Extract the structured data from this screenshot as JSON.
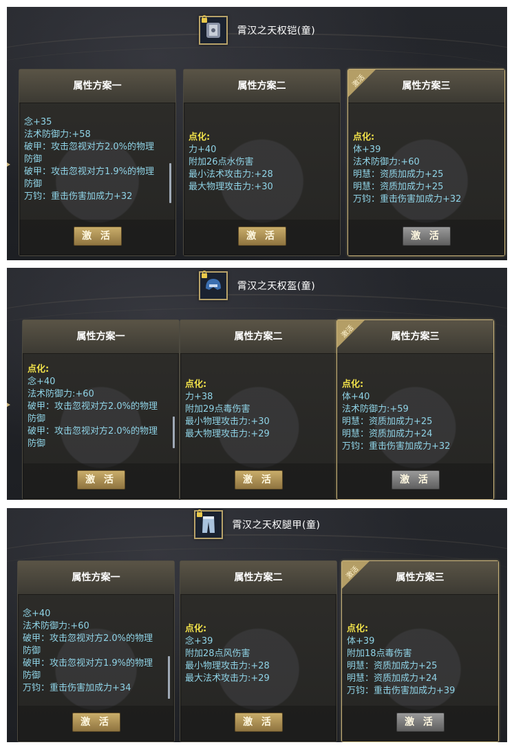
{
  "panels": [
    {
      "item_name": "霄汉之天权铠(童)",
      "item_icon": "armor-icon",
      "button_label": "激 活",
      "active_ribbon": "激活",
      "cards": [
        {
          "title": "属性方案一",
          "lines": [
            "念+35",
            "法术防御力:+58",
            "破甲：攻击忽视对方2.0%的物理",
            "防御",
            "破甲：攻击忽视对方1.9%的物理",
            "防御",
            "万钧：重击伤害加成力+32"
          ]
        },
        {
          "title": "属性方案二",
          "lines": [
            "点化:",
            "力+40",
            "附加26点水伤害",
            "最小法术攻击力:+28",
            "最大物理攻击力:+30"
          ]
        },
        {
          "title": "属性方案三",
          "lines": [
            "点化:",
            "体+39",
            "法术防御力:+60",
            "明慧：资质加成力+25",
            "明慧：资质加成力+25",
            "万钧：重击伤害加成力+32"
          ]
        }
      ]
    },
    {
      "item_name": "霄汉之天权盔(童)",
      "item_icon": "helmet-icon",
      "button_label": "激 活",
      "active_ribbon": "激活",
      "cards": [
        {
          "title": "属性方案一",
          "lines": [
            "点化:",
            "念+40",
            "法术防御力:+60",
            "破甲：攻击忽视对方2.0%的物理",
            "防御",
            "破甲：攻击忽视对方2.0%的物理",
            "防御"
          ]
        },
        {
          "title": "属性方案二",
          "lines": [
            "点化:",
            "力+38",
            "附加29点毒伤害",
            "最小物理攻击力:+30",
            "最大物理攻击力:+29"
          ]
        },
        {
          "title": "属性方案三",
          "lines": [
            "点化:",
            "体+40",
            "法术防御力:+59",
            "明慧：资质加成力+25",
            "明慧：资质加成力+24",
            "万钧：重击伤害加成力+32"
          ]
        }
      ]
    },
    {
      "item_name": "霄汉之天权腿甲(童)",
      "item_icon": "leggings-icon",
      "button_label": "激 活",
      "active_ribbon": "激活",
      "cards": [
        {
          "title": "属性方案一",
          "lines": [
            "念+40",
            "法术防御力:+60",
            "破甲：攻击忽视对方2.0%的物理",
            "防御",
            "破甲：攻击忽视对方1.9%的物理",
            "防御",
            "万钧：重击伤害加成力+34"
          ]
        },
        {
          "title": "属性方案二",
          "lines": [
            "点化:",
            "念+39",
            "附加28点风伤害",
            "最小物理攻击力:+28",
            "最大法术攻击力:+29"
          ]
        },
        {
          "title": "属性方案三",
          "lines": [
            "点化:",
            "体+39",
            "附加18点毒伤害",
            "明慧：资质加成力+25",
            "明慧：资质加成力+24",
            "万钧：重击伤害加成力+39"
          ]
        }
      ]
    }
  ]
}
